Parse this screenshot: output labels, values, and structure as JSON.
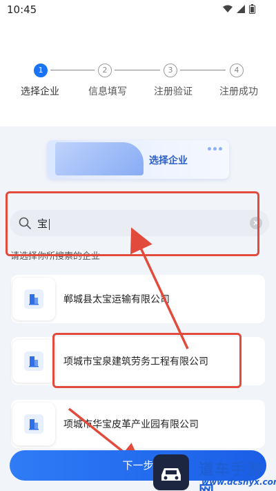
{
  "status_bar": {
    "time": "10:45"
  },
  "steps": [
    {
      "number": "1",
      "label": "选择企业",
      "active": true
    },
    {
      "number": "2",
      "label": "信息填写",
      "active": false
    },
    {
      "number": "3",
      "label": "注册验证",
      "active": false
    },
    {
      "number": "4",
      "label": "注册成功",
      "active": false
    }
  ],
  "banner": {
    "title": "选择企业"
  },
  "search": {
    "value": "宝",
    "icon": "search-icon"
  },
  "hint": "请选择你所搜索的企业",
  "companies": [
    {
      "name": "郸城县太宝运输有限公司"
    },
    {
      "name": "项城市宝泉建筑劳务工程有限公司"
    },
    {
      "name": "项城市华宝皮革产业园有限公司"
    }
  ],
  "next_button": {
    "label": "下一步"
  },
  "watermark": {
    "title": "道车手游网",
    "url": "www.dcshyx.com"
  },
  "colors": {
    "accent": "#1a73f5",
    "annotation": "#e24a3b"
  }
}
